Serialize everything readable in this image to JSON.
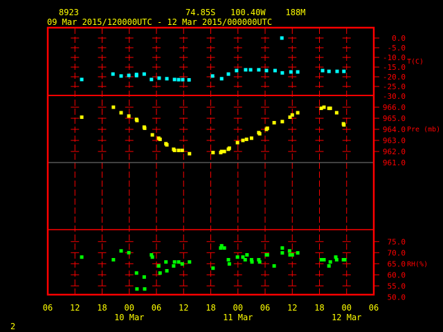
{
  "header": {
    "station_id": "8923",
    "location": "74.85S   100.40W    188M",
    "time_range": "09 Mar 2015/120000UTC - 12 Mar 2015/000000UTC"
  },
  "footer": {
    "page_number": "2"
  },
  "colors": {
    "frame": "#ff0000",
    "text": "#ffff00",
    "temperature": "#00ffff",
    "pressure": "#ffff00",
    "rh": "#00ff00",
    "axis_label": "#ff0000"
  },
  "chart_data": [
    {
      "type": "scatter",
      "name": "temperature",
      "ylabel": "T(C)",
      "ylim": [
        -30,
        0
      ],
      "yticks": [
        "0.0",
        "-5.0",
        "-10.0",
        "-15.0",
        "-20.0",
        "-25.0",
        "-30.0"
      ],
      "ytick_values": [
        0,
        -5,
        -10,
        -15,
        -20,
        -25,
        -30
      ],
      "x_hours": [
        7.5,
        14.4,
        16.2,
        17.9,
        19.6,
        19.6,
        21.3,
        22.9,
        24.6,
        26.3,
        28,
        28.9,
        29.8,
        31.2,
        36.4,
        38.4,
        39.9,
        41.7,
        43.7,
        44.8,
        46.6,
        48.3,
        50.2,
        51.7,
        51.8,
        53.7,
        55.2,
        60.7,
        62.1,
        63.9,
        65.4
      ],
      "values": [
        -21.4,
        -18.6,
        -19.6,
        -19.3,
        -18.8,
        -19.4,
        -18.6,
        -21.4,
        -20.7,
        -21,
        -21.4,
        -21.5,
        -21.5,
        -21.6,
        -19.6,
        -21,
        -18.6,
        -16.8,
        -16.4,
        -16.4,
        -16.4,
        -16.8,
        -16.8,
        0,
        -18,
        -17.5,
        -17.5,
        -16.8,
        -17.2,
        -17.2,
        -17.2
      ]
    },
    {
      "type": "scatter",
      "name": "pressure",
      "ylabel": "Pre (mb)",
      "ylim": [
        955,
        967
      ],
      "yticks": [
        "966.0",
        "965.0",
        "964.0",
        "963.0",
        "962.0",
        "961.0"
      ],
      "ytick_values": [
        966,
        965,
        964,
        963,
        962,
        961
      ],
      "x_hours": [
        7.5,
        14.5,
        16.2,
        17.9,
        19.6,
        19.7,
        21.3,
        21.4,
        23.1,
        24.5,
        24.8,
        26.1,
        26.3,
        27.8,
        28,
        28.9,
        29.7,
        31.3,
        36.5,
        38.2,
        38.4,
        39,
        39.9,
        40.1,
        41.9,
        43.1,
        43.9,
        45,
        46.6,
        46.8,
        48.3,
        48.5,
        50,
        51.8,
        53.5,
        54,
        55.2,
        60.4,
        61,
        62.1,
        62.4,
        63.8,
        65.3,
        65.4
      ],
      "values": [
        965.1,
        966,
        965.5,
        965.2,
        964.9,
        964.8,
        964.2,
        964.1,
        963.5,
        963.2,
        963.1,
        962.7,
        962.6,
        962.2,
        962.1,
        962.1,
        962.1,
        961.8,
        961.9,
        961.9,
        962,
        962,
        962.2,
        962.3,
        962.8,
        963,
        963.1,
        963.2,
        963.7,
        963.6,
        964,
        964.1,
        964.6,
        964.7,
        965.1,
        965.3,
        965.5,
        965.9,
        966,
        965.9,
        965.9,
        965.5,
        964.5,
        964.4
      ]
    },
    {
      "type": "scatter",
      "name": "rh",
      "ylabel": "RH(%)",
      "ylim": [
        50,
        75
      ],
      "yticks": [
        "75.0",
        "70.0",
        "65.0",
        "60.0",
        "55.0",
        "50.0"
      ],
      "ytick_values": [
        75,
        70,
        65,
        60,
        55,
        50
      ],
      "x_hours": [
        7.5,
        14.5,
        16.2,
        17.9,
        19.6,
        19.7,
        21.3,
        21.4,
        22.9,
        23.1,
        24.5,
        24.8,
        26.1,
        26.3,
        27.8,
        28,
        28.9,
        29.7,
        31.3,
        36.5,
        38.2,
        38.4,
        39,
        39.9,
        40.1,
        41.9,
        43.1,
        43.6,
        44,
        45,
        45.1,
        46.6,
        46.8,
        48.3,
        48.5,
        50,
        51.8,
        51.8,
        53.4,
        53.5,
        54,
        55.2,
        60.4,
        61,
        62.1,
        62.4,
        63.6,
        63.8,
        65.3,
        65.6
      ],
      "values": [
        68,
        66.8,
        70.8,
        70,
        60.8,
        53.6,
        59,
        53.6,
        69,
        68,
        64,
        60.8,
        65.8,
        61.8,
        64,
        65.8,
        65.8,
        64.9,
        65.8,
        63,
        72.1,
        73.1,
        72.1,
        66.8,
        64.9,
        68,
        68,
        66.8,
        69,
        66.8,
        65.8,
        66.8,
        65.8,
        69,
        69,
        64,
        72.1,
        69.9,
        70.8,
        69,
        69,
        69.9,
        66.8,
        66.8,
        64,
        65.8,
        68,
        66.8,
        66.8,
        66.8
      ]
    }
  ],
  "x_axis": {
    "range_hours": [
      0,
      72
    ],
    "tick_labels": [
      "06",
      "12",
      "18",
      "00",
      "06",
      "12",
      "18",
      "00",
      "06",
      "12",
      "18",
      "00",
      "06"
    ],
    "date_labels": [
      {
        "label": "10 Mar",
        "hour": 18
      },
      {
        "label": "11 Mar",
        "hour": 42
      },
      {
        "label": "12 Mar",
        "hour": 66
      }
    ]
  }
}
